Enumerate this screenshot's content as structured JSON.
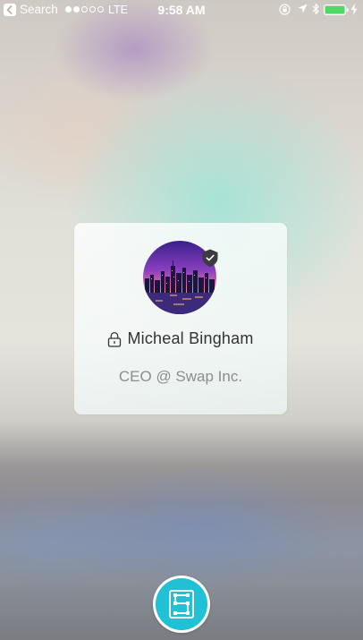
{
  "status_bar": {
    "back_label": "Search",
    "signal_bars_filled": 2,
    "signal_bars_total": 5,
    "carrier": "LTE",
    "time": "9:58 AM",
    "battery_level": 1.0,
    "battery_color": "#4cd964"
  },
  "profile": {
    "name": "Micheal Bingham",
    "title": "CEO @ Swap Inc.",
    "avatar": "city-skyline-photo",
    "badge_icon": "shield-check-icon",
    "lock_icon": "lock-icon"
  },
  "swap_button": {
    "icon": "swap-logo-icon",
    "color": "#20c1d5"
  }
}
